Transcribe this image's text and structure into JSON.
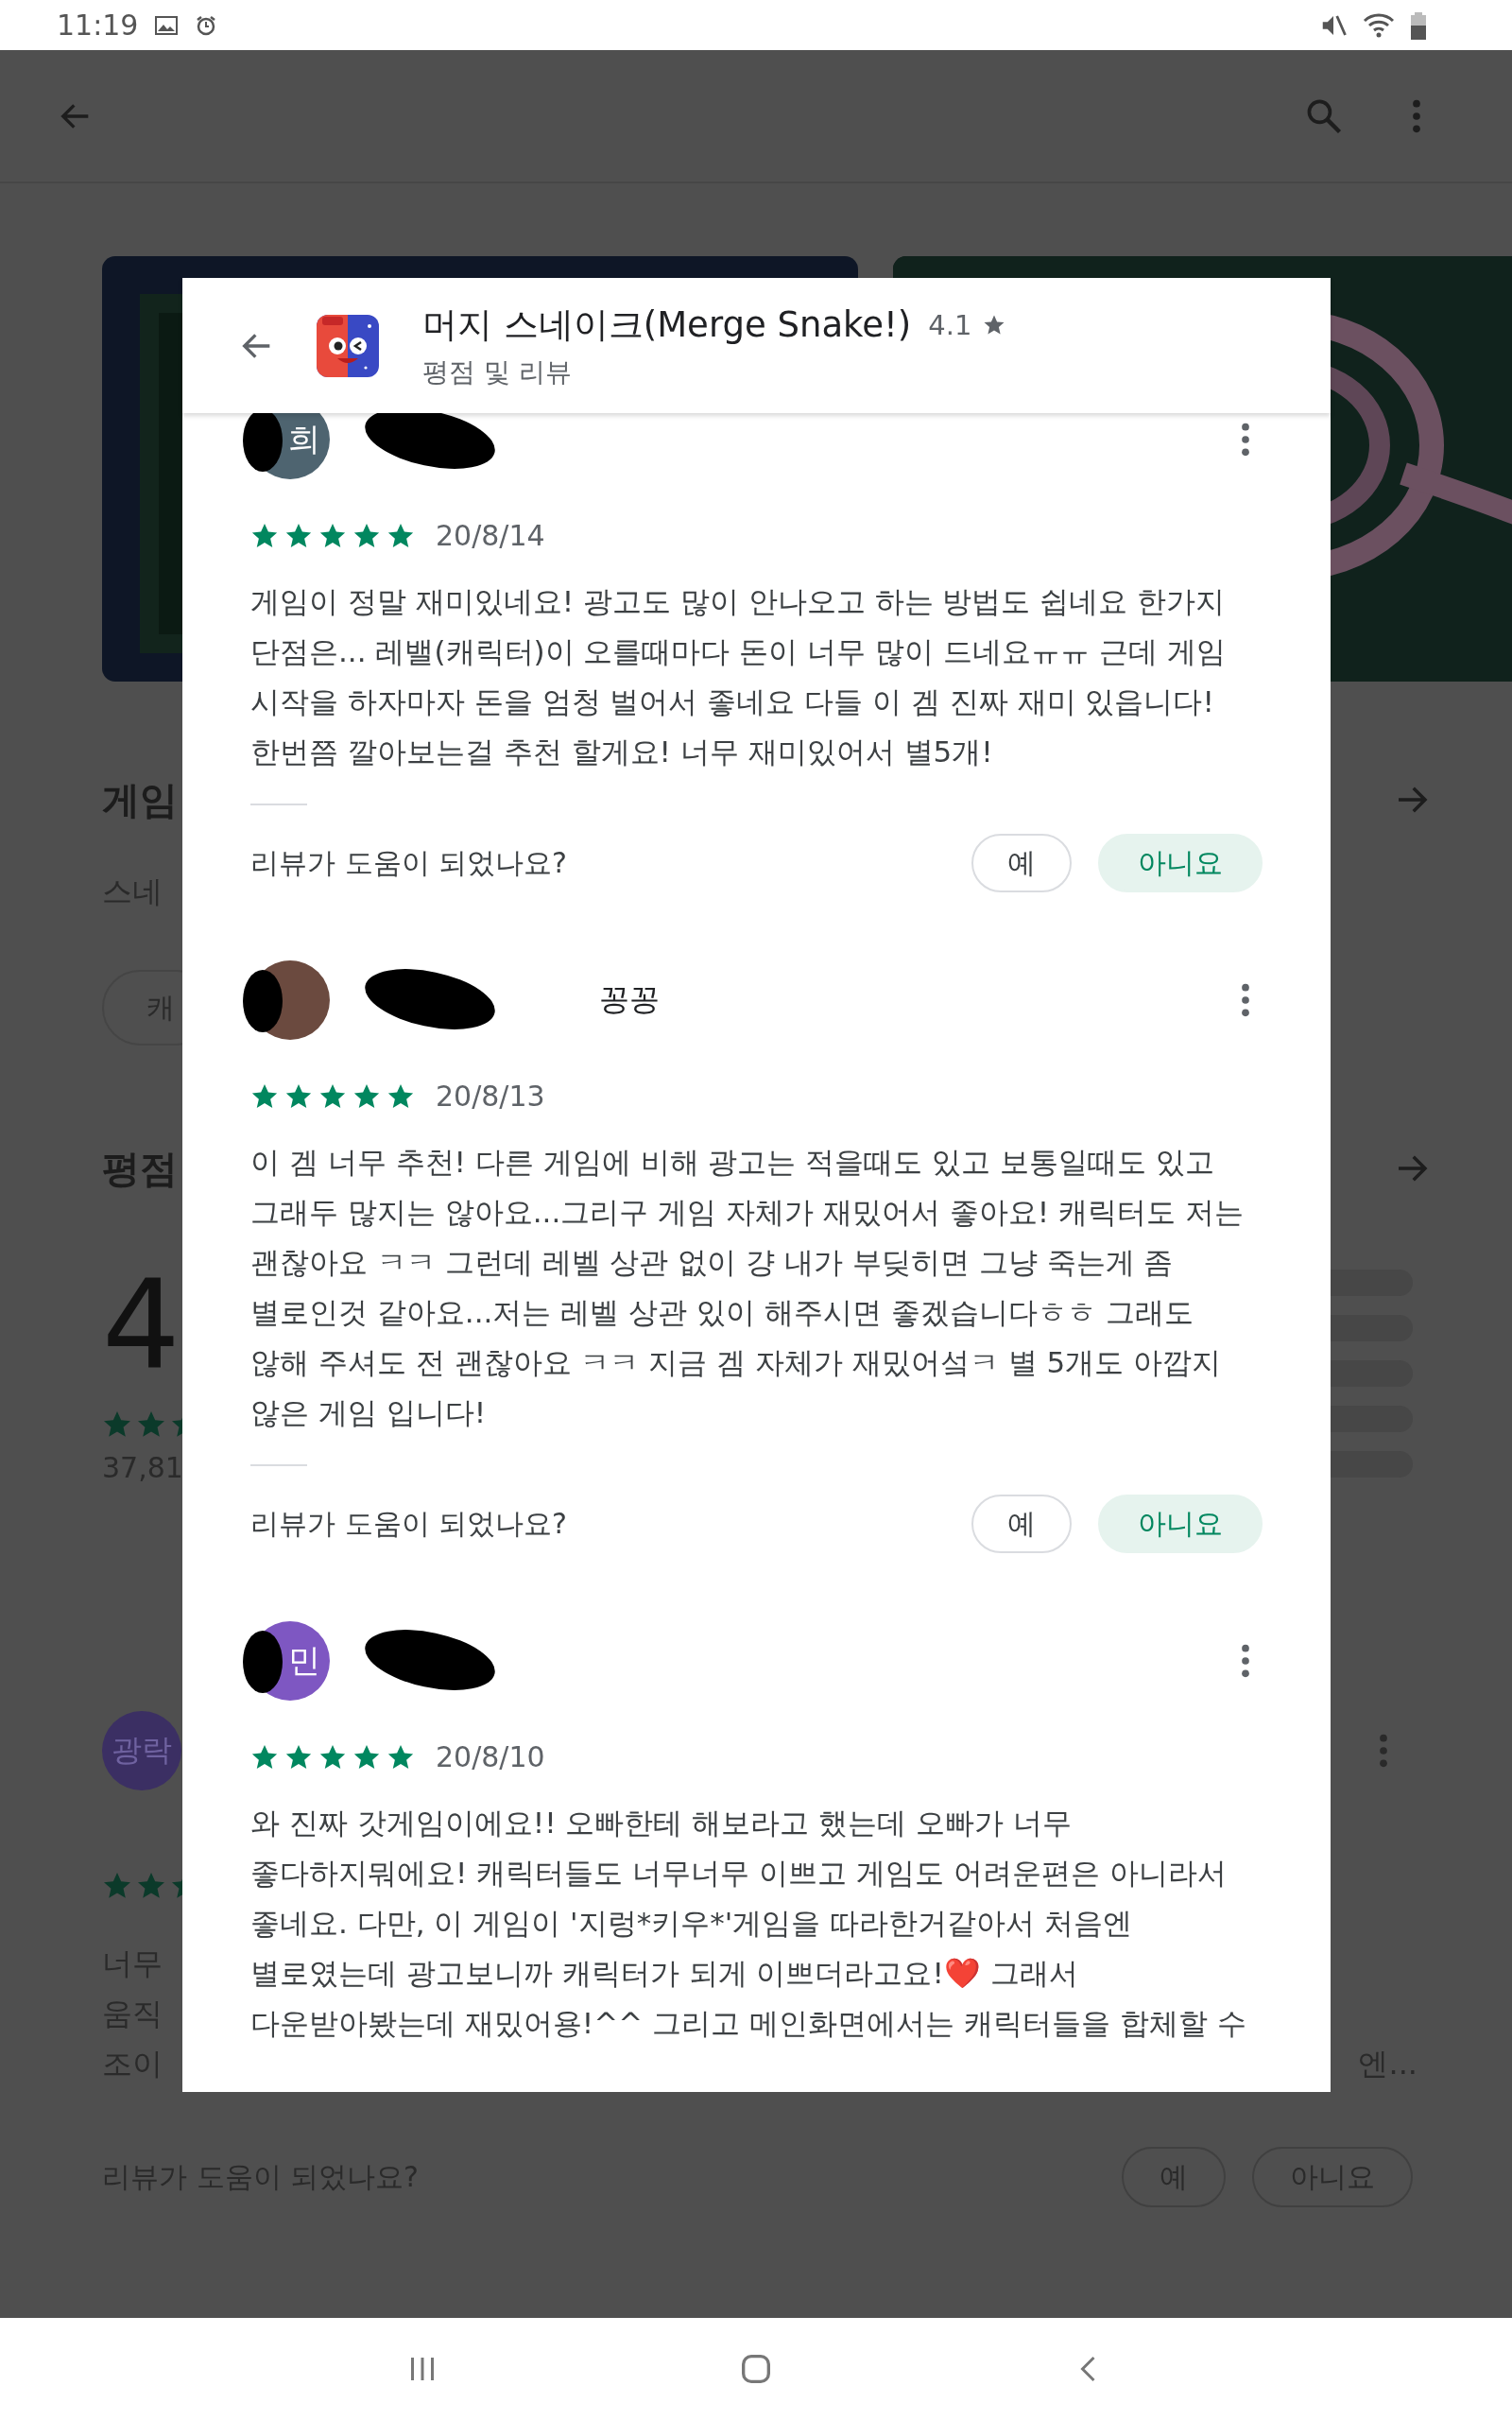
{
  "status_bar": {
    "time": "11:19"
  },
  "background_page": {
    "about_heading": "게임",
    "about_text": "스네",
    "tag_chip": "캐",
    "ratings_heading": "평점",
    "rating_score": "4",
    "rating_count": "37,81",
    "review": {
      "avatar_initial": "광락",
      "color": "#3b2f63",
      "text_lines": [
        "너무",
        "움직",
        "조이"
      ],
      "text_tail": "엔...",
      "helpful_prompt": "리뷰가 도움이 되었나요?",
      "votes": [
        {
          "label": "예",
          "selected": false
        },
        {
          "label": "아니요",
          "selected": false
        }
      ]
    }
  },
  "dialog": {
    "app_name": "머지 스네이크(Merge Snake!)",
    "rating": "4.1",
    "subtitle": "평점 및 리뷰",
    "reviews": [
      {
        "avatar_initial": "희",
        "color": "#4e6470",
        "stars": 5,
        "date": "20/8/14",
        "text": "게임이 정말 재미있네요! 광고도 많이 안나오고 하는 방법도 쉽네요 한가지\n단점은... 레밸(캐릭터)이 오를때마다 돈이 너무 많이 드네요ㅠㅠ 근데 게임\n시작을 하자마자 돈을 엄청 벌어서 좋네요 다들 이 겜 진짜 재미 있읍니다!\n한번쯤 깔아보는걸 추천 할게요! 너무 재미있어서 별5개!",
        "helpful_prompt": "리뷰가 도움이 되었나요?",
        "votes": [
          {
            "label": "예",
            "selected": false
          },
          {
            "label": "아니요",
            "selected": true
          }
        ]
      },
      {
        "name": "꽁꽁",
        "color": "#6b4a3f",
        "stars": 5,
        "date": "20/8/13",
        "text": "이 겜 너무 추천! 다른 게임에 비해 광고는 적을때도 있고 보통일때도 있고\n그래두 많지는 않아요...그리구 게임 자체가 재밌어서 좋아요! 캐릭터도 저는\n괜찮아요 ㅋㅋ 그런데 레벨 상관 없이 걍 내가 부딪히면 그냥 죽는게 좀\n별로인것 같아요...저는 레벨 상관 있이 해주시면 좋겠습니다ㅎㅎ 그래도\n않해 주셔도 전 괜찮아요 ㅋㅋ 지금 겜 자체가 재밌어섴ㅋ 별 5개도 아깝지\n않은 게임 입니다!",
        "helpful_prompt": "리뷰가 도움이 되었나요?",
        "votes": [
          {
            "label": "예",
            "selected": false
          },
          {
            "label": "아니요",
            "selected": true
          }
        ]
      },
      {
        "avatar_initial": "민",
        "color": "#7e57c2",
        "stars": 5,
        "date": "20/8/10",
        "text": "와 진짜 갓게임이에요!! 오빠한테 해보라고 했는데 오빠가 너무\n좋다하지뭐에요! 캐릭터들도 너무너무 이쁘고 게임도 어려운편은 아니라서\n좋네요. 다만, 이 게임이 '지렁*키우*'게임을 따라한거같아서 처음엔\n별로였는데 광고보니까 캐릭터가 되게 이쁘더라고요!❤️ 그래서\n다운받아봤는데 재밌어용!^^ 그리고 메인화면에서는 캐릭터들을 합체할 수"
      }
    ]
  }
}
